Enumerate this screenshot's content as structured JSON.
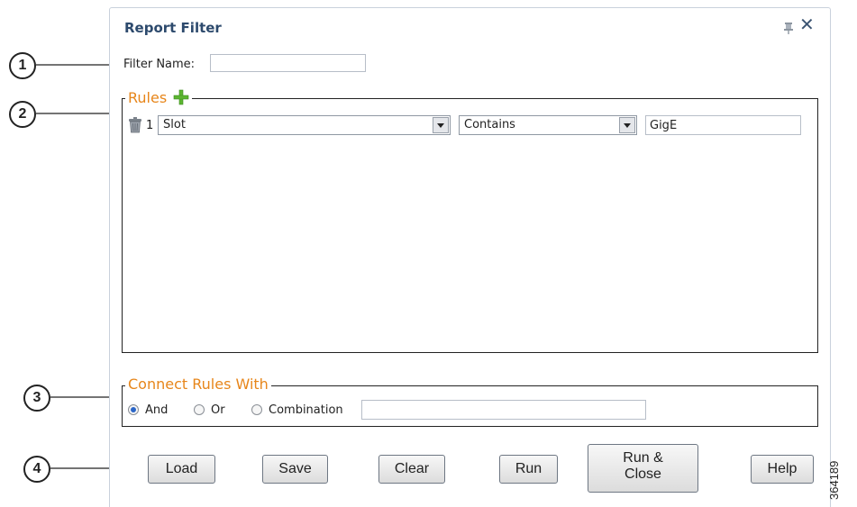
{
  "dialog": {
    "title": "Report Filter",
    "pin_icon": "pin-icon",
    "close_label": "✕"
  },
  "callouts": [
    "1",
    "2",
    "3",
    "4"
  ],
  "filter_name": {
    "label": "Filter Name:",
    "value": ""
  },
  "rules": {
    "legend": "Rules",
    "add_icon": "plus-icon",
    "rows": [
      {
        "delete_icon": "trash-icon",
        "number": "1",
        "field": "Slot",
        "operator": "Contains",
        "value": "GigE"
      }
    ]
  },
  "connect": {
    "legend": "Connect Rules With",
    "options": [
      {
        "label": "And",
        "checked": true
      },
      {
        "label": "Or",
        "checked": false
      },
      {
        "label": "Combination",
        "checked": false
      }
    ],
    "combination_value": ""
  },
  "buttons": {
    "load": "Load",
    "save": "Save",
    "clear": "Clear",
    "run": "Run",
    "run_close_1": "Run &",
    "run_close_2": "Close",
    "help": "Help"
  },
  "figure_number": "364189",
  "colors": {
    "title": "#2d4a6d",
    "legend": "#e7861b",
    "add_icon": "#5cb531",
    "radio_selected": "#2b66c7"
  }
}
